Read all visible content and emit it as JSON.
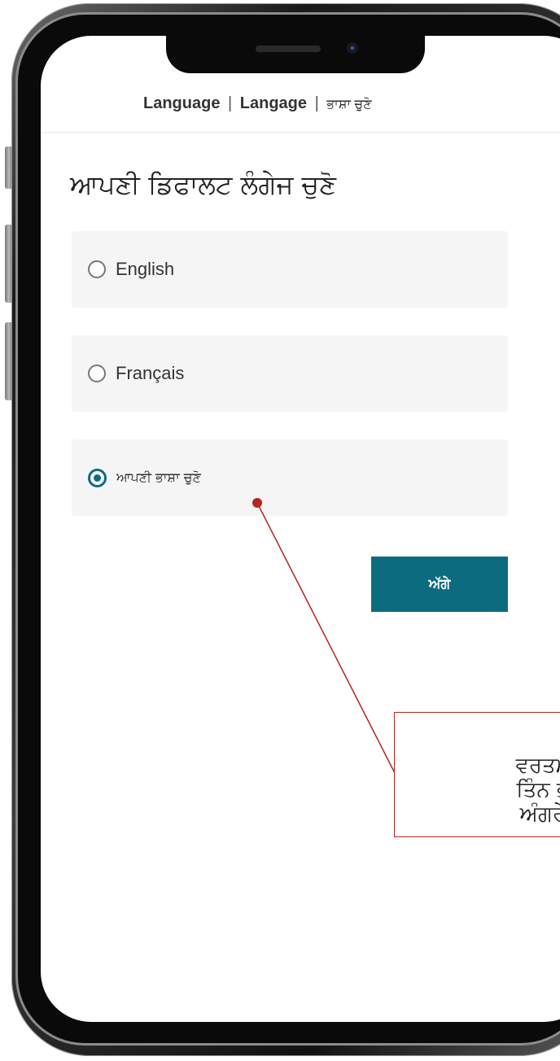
{
  "header": {
    "title_part1": "Language",
    "title_separator1": "|",
    "title_part2": "Langage",
    "title_separator2": "|",
    "title_part3": "ਭਾਸ਼ਾ ਚੁਣੋ"
  },
  "main": {
    "page_title": "ਆਪਣੀ ਡਿਫਾਲਟ ਲੰਗੇਜ ਚੁਣੋ",
    "options": [
      {
        "label": "English",
        "selected": false
      },
      {
        "label": "Français",
        "selected": false
      },
      {
        "label": "ਆਪਣੀ ਭਾਸ਼ਾ ਚੁਣੋ",
        "selected": true
      }
    ],
    "next_button_label": "ਅੱਗੇ"
  },
  "annotation": {
    "line1": "ਵਰਤਮਾਨ ਵਿੱ",
    "line2": "ਤਿੰਨ ਭਾਸ਼ਾਵਾਂ",
    "line3": "ਅੰਗਰੇਜ਼ੀ, ਫ੍ਰੈ"
  },
  "colors": {
    "accent": "#0d6b80",
    "annotation": "#b3261e",
    "option_bg": "#f5f5f5"
  }
}
